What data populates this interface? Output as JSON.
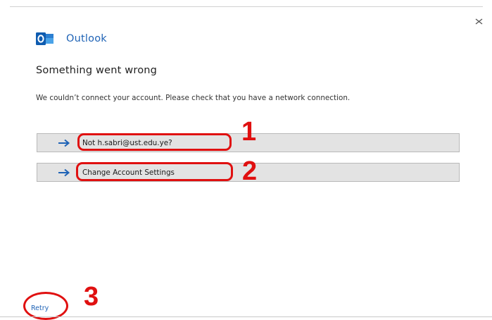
{
  "app": {
    "name": "Outlook",
    "logo_icon": "outlook-logo-icon",
    "brand_color": "#1f63b6"
  },
  "dialog": {
    "heading": "Something went wrong",
    "message": "We couldn’t connect your account.  Please check that you have a network connection.",
    "close_icon": "close-icon"
  },
  "actions": [
    {
      "label": "Not h.sabri@ust.edu.ye?",
      "icon": "arrow-right-icon"
    },
    {
      "label": "Change Account Settings",
      "icon": "arrow-right-icon"
    }
  ],
  "footer": {
    "retry_label": "Retry"
  },
  "annotations": {
    "color": "#e01010",
    "numbers": [
      "1",
      "2",
      "3"
    ]
  }
}
